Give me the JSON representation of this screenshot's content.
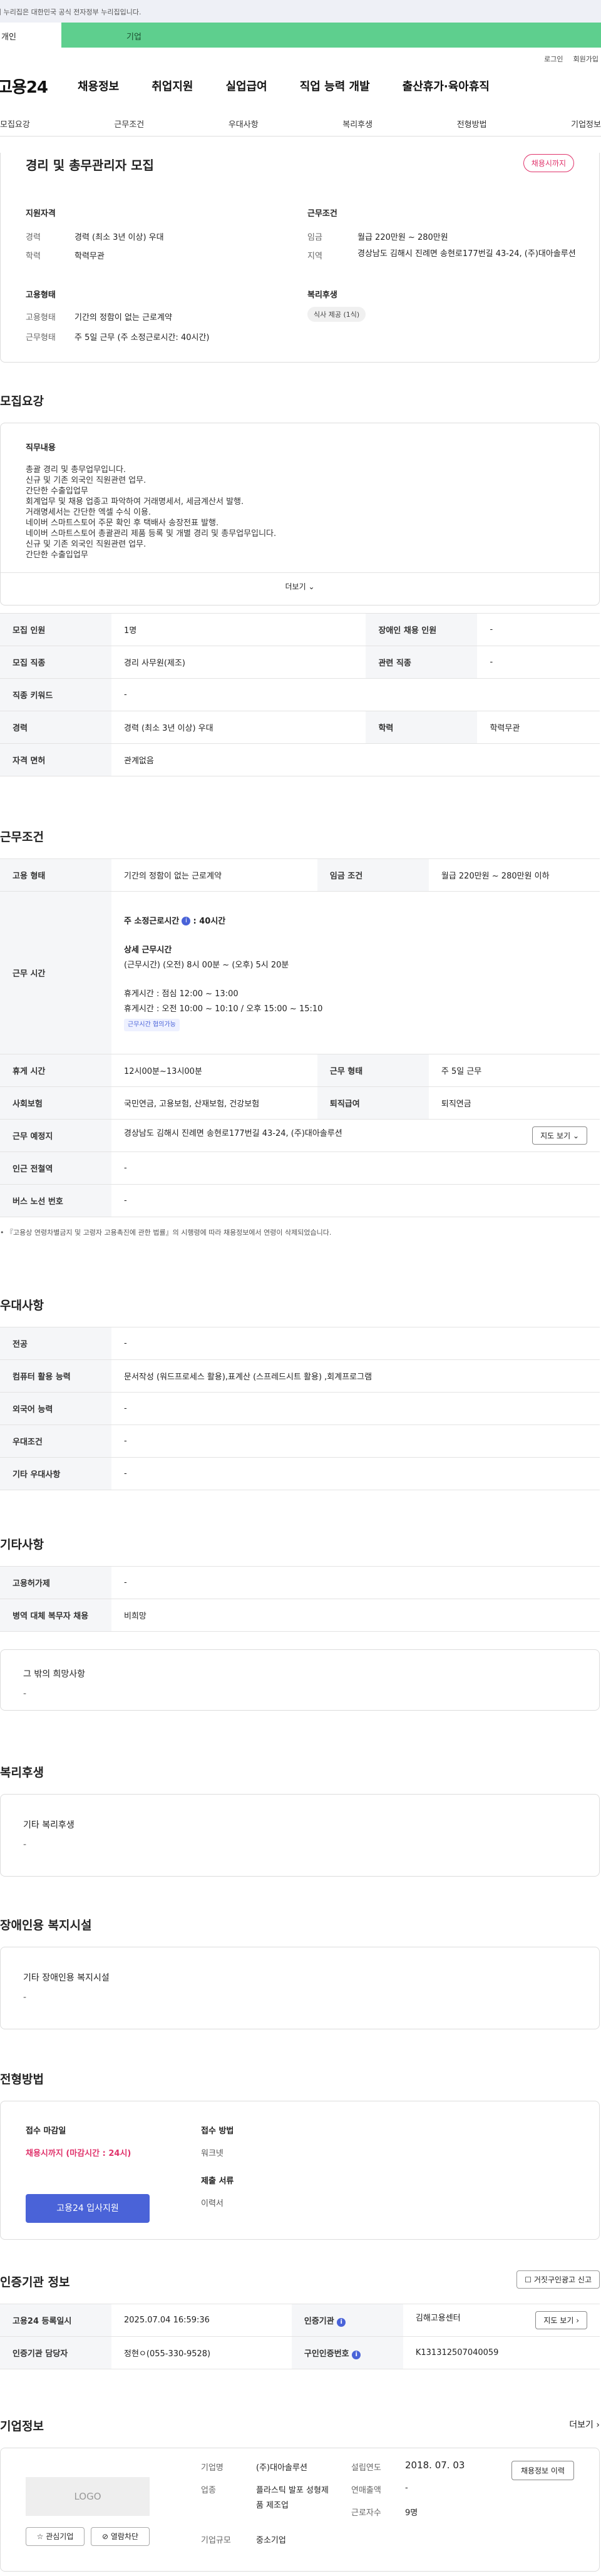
{
  "gov_banner": "이 누리집은 대한민국 공식 전자정부 누리집입니다.",
  "tabs": {
    "person": "개인",
    "biz": "기업"
  },
  "util": {
    "login": "로그인",
    "join": "회원가입"
  },
  "gnb": {
    "logo": "고용24",
    "items": [
      "채용정보",
      "취업지원",
      "실업급여",
      "직업 능력 개발",
      "출산휴가·육아휴직"
    ]
  },
  "snb": [
    "모집요강",
    "근무조건",
    "우대사항",
    "복리후생",
    "전형방법",
    "기업정보"
  ],
  "summary": {
    "title": "경리 및 총무관리자 모집",
    "badge": "채용시까지",
    "qual_title": "지원자격",
    "career_lbl": "경력",
    "career": "경력 (최소 3년 이상) 우대",
    "edu_lbl": "학력",
    "edu": "학력무관",
    "cond_title": "근무조건",
    "wage_lbl": "임금",
    "wage": "월급 220만원 ~ 280만원",
    "region_lbl": "지역",
    "region": "경상남도 김해시 진례면 송현로177번길 43-24, (주)대아솔루션",
    "emp_title": "고용형태",
    "emptype_lbl": "고용형태",
    "emptype": "기간의 정함이 없는 근로계약",
    "worktype_lbl": "근무형태",
    "worktype": "주 5일 근무 (주 소정근로시간: 40시간)",
    "welfare_title": "복리후생",
    "welfare_tag": "식사 제공 (1식)"
  },
  "recruit": {
    "title": "모집요강",
    "duty_lbl": "직무내용",
    "duty_lines": [
      "총괄 경리 및 총무업무입니다.",
      "신규 및 기존 외국인 직원관련 업무.",
      "간단한 수출입업무",
      "회계업무 및 채용 업종고 파악하여 거래명세서, 세금계산서 발행.",
      "거래명세서는 간단한 엑셀 수식 이용.",
      "네이버 스마트스토어 주문 확인 후 택배사 송장전표 발행.",
      "네이버 스마트스토어 총괄관리 제품 등록 및 개별 경리 및 총무업무입니다.",
      "신규 및 기존 외국인 직원관련 업무.",
      "간단한 수출입업무"
    ],
    "more": "더보기",
    "rows": [
      [
        "모집 인원",
        "1명",
        "장애인 채용 인원",
        "-"
      ],
      [
        "모집 직종",
        "경리 사무원(제조)",
        "관련 직종",
        "-"
      ],
      [
        "직종 키워드",
        "-",
        "",
        ""
      ],
      [
        "경력",
        "경력 (최소 3년 이상) 우대",
        "학력",
        "학력무관"
      ],
      [
        "자격 면허",
        "관계없음",
        "",
        ""
      ]
    ]
  },
  "work": {
    "title": "근무조건",
    "emptype_lbl": "고용 형태",
    "emptype": "기간의 정함이 없는 근로계약",
    "wage_lbl": "임금 조건",
    "wage": "월급 220만원 ~ 280만원 이하",
    "hours_lbl": "근무 시간",
    "hours_head": "주 소정근로시간",
    "hours_val": ": 40시간",
    "detail_lbl": "상세 근무시간",
    "detail": "(근무시간) (오전) 8시 00분 ~ (오후) 5시 20분",
    "break1": "휴게시간 : 점심 12:00 ~ 13:00",
    "break2": "휴게시간 : 오전 10:00 ~ 10:10  /  오후 15:00 ~ 15:10",
    "flex_tag": "근무시간 협의가능",
    "rest_lbl": "휴게 시간",
    "rest": "12시00분~13시00분",
    "form_lbl": "근무 형태",
    "form": "주 5일 근무",
    "ins_lbl": "사회보험",
    "ins": "국민연금, 고용보험, 산재보험, 건강보험",
    "sev_lbl": "퇴직급여",
    "sev": "퇴직연금",
    "place_lbl": "근무 예정지",
    "place": "경상남도 김해시 진례면 송현로177번길 43-24, (주)대아솔루션",
    "map": "지도 보기",
    "station_lbl": "인근 전철역",
    "station": "-",
    "bus_lbl": "버스 노선 번호",
    "bus": "-",
    "note": "『고용상 연령차별금지 및 고령자 고용촉진에 관한 법률』의 시행령에 따라 채용정보에서 연령이 삭제되었습니다."
  },
  "pref": {
    "title": "우대사항",
    "rows": [
      [
        "전공",
        "-"
      ],
      [
        "컴퓨터 활용 능력",
        "문서작성 (워드프로세스 활용),표계산 (스프레드시트 활용) ,회계프로그램"
      ],
      [
        "외국어 능력",
        "-"
      ],
      [
        "우대조건",
        "-"
      ],
      [
        "기타 우대사항",
        "-"
      ]
    ]
  },
  "etc": {
    "title": "기타사항",
    "rows": [
      [
        "고용허가제",
        "-"
      ],
      [
        "병역 대체 복무자 채용",
        "비희망"
      ]
    ],
    "hope_lbl": "그 밖의 희망사항",
    "hope": "-"
  },
  "welfare": {
    "title": "복리후생",
    "lbl": "기타 복리후생",
    "val": "-"
  },
  "disabled": {
    "title": "장애인용 복지시설",
    "lbl": "기타 장애인용 복지시설",
    "val": "-"
  },
  "select": {
    "title": "전형방법",
    "deadline_lbl": "접수 마감일",
    "deadline": "채용시까지 (마감시간 : 24시)",
    "method_lbl": "접수 방법",
    "method": "워크넷",
    "docs_lbl": "제출 서류",
    "docs": "이력서",
    "apply": "고용24 입사지원"
  },
  "agency": {
    "title": "인증기관 정보",
    "report": "거짓구인광고 신고",
    "reg_lbl": "고용24 등록일시",
    "reg": "2025.07.04 16:59:36",
    "org_lbl": "인증기관",
    "org": "김해고용센터",
    "map": "지도 보기",
    "mgr_lbl": "인증기관 담당자",
    "mgr": "정현ㅇ(055-330-9528)",
    "no_lbl": "구인인증번호",
    "no": "K131312507040059"
  },
  "company": {
    "title": "기업정보",
    "more": "더보기",
    "logo": "LOGO",
    "fav": "관심기업",
    "block": "열람차단",
    "name_lbl": "기업명",
    "name": "(주)대아솔루션",
    "ind_lbl": "업종",
    "ind": "플라스틱 발포 성형제품 제조업",
    "size_lbl": "기업규모",
    "size": "중소기업",
    "est_lbl": "설립연도",
    "est": "2018. 07. 03",
    "sales_lbl": "연매출액",
    "sales": "-",
    "emp_lbl": "근로자수",
    "emp": "9명",
    "jobs": "채용정보 이력"
  }
}
